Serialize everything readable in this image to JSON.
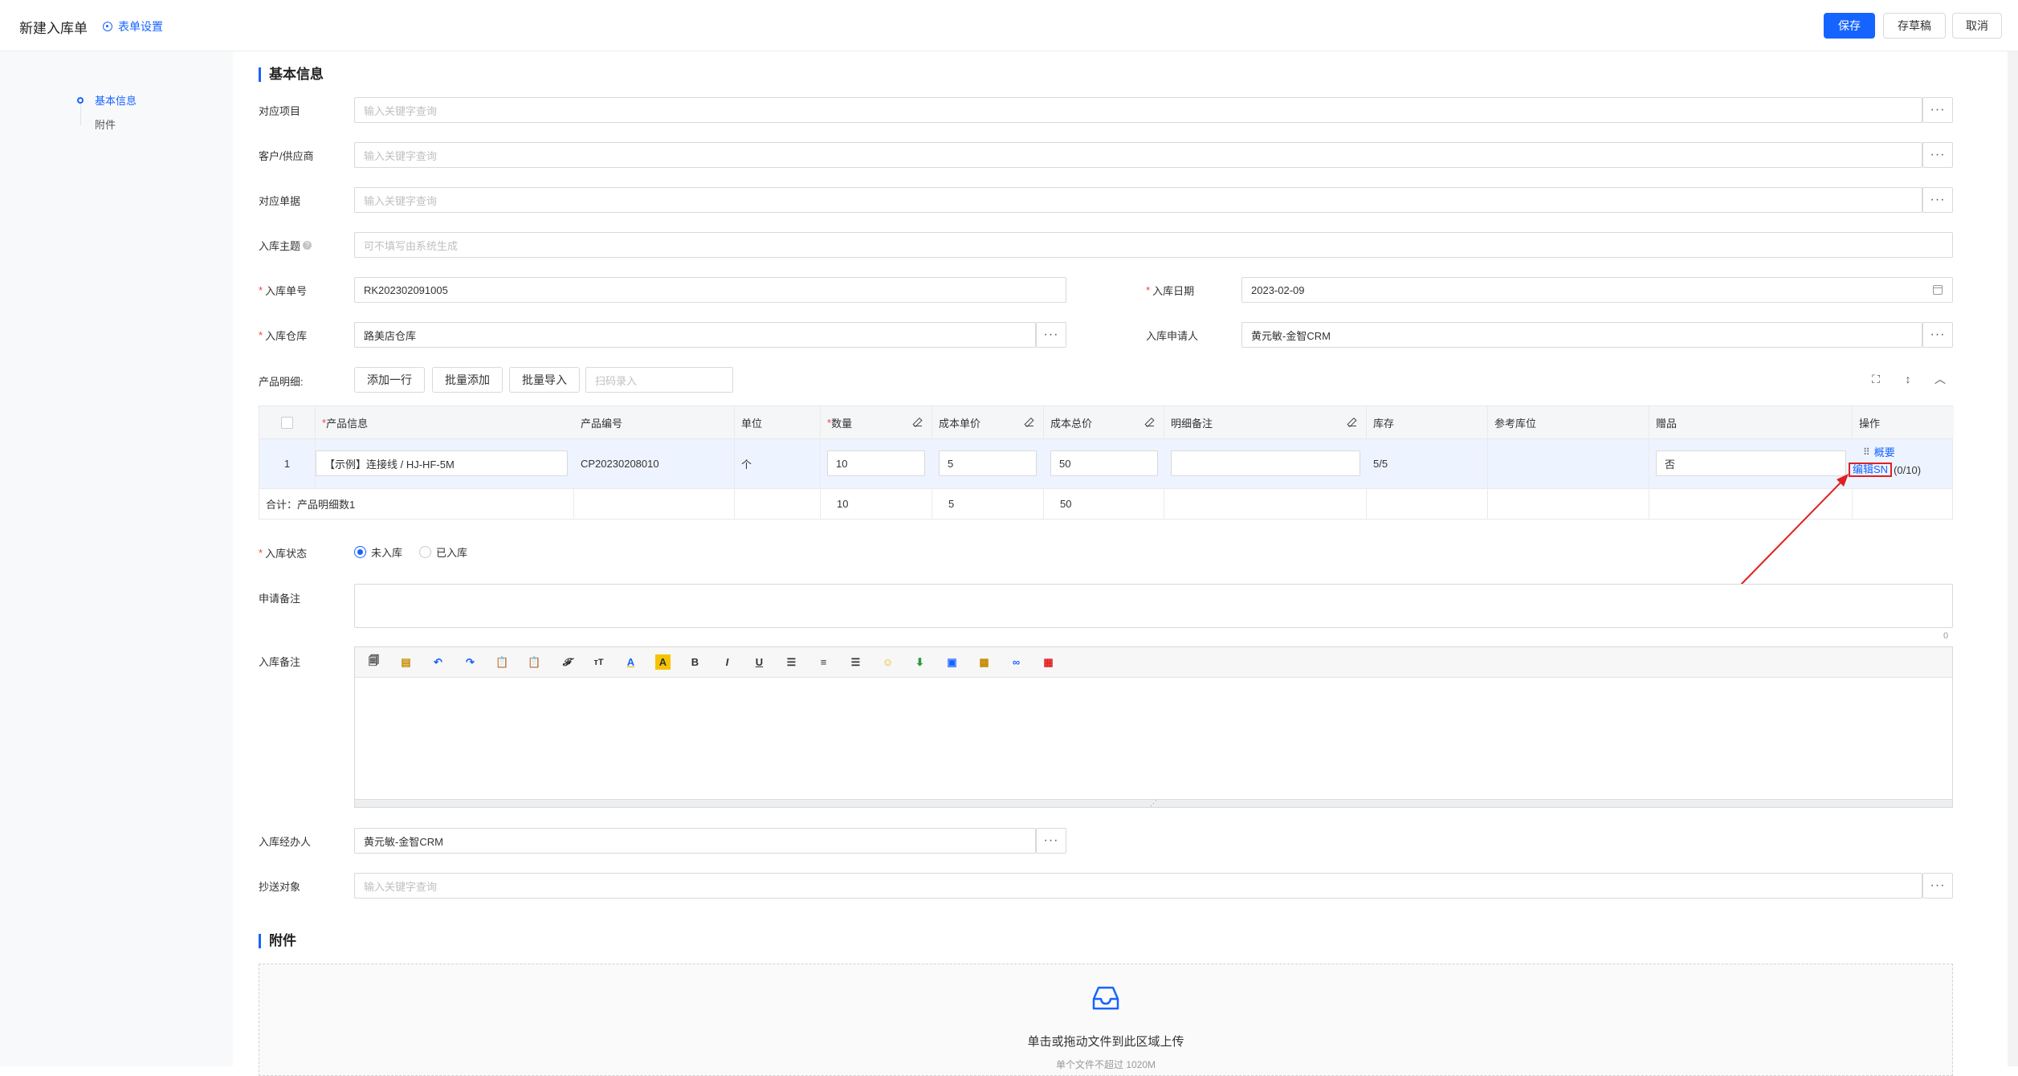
{
  "header": {
    "title": "新建入库单",
    "form_settings": "表单设置",
    "save": "保存",
    "draft": "存草稿",
    "cancel": "取消"
  },
  "sidebar": {
    "items": [
      {
        "label": "基本信息",
        "active": true
      },
      {
        "label": "附件",
        "active": false
      }
    ]
  },
  "sections": {
    "basic": "基本信息",
    "attachment": "附件"
  },
  "fields": {
    "project": {
      "label": "对应项目",
      "placeholder": "输入关键字查询"
    },
    "customer": {
      "label": "客户/供应商",
      "placeholder": "输入关键字查询"
    },
    "document": {
      "label": "对应单据",
      "placeholder": "输入关键字查询"
    },
    "subject": {
      "label": "入库主题",
      "placeholder": "可不填写由系统生成"
    },
    "number": {
      "label": "入库单号",
      "value": "RK202302091005"
    },
    "date": {
      "label": "入库日期",
      "value": "2023-02-09"
    },
    "warehouse": {
      "label": "入库仓库",
      "value": "路美店仓库"
    },
    "applicant": {
      "label": "入库申请人",
      "value": "黄元敏-金智CRM"
    },
    "products_label": "产品明细:",
    "status": {
      "label": "入库状态",
      "options": [
        "未入库",
        "已入库"
      ],
      "selected": "未入库"
    },
    "apply_note": {
      "label": "申请备注",
      "count": "0"
    },
    "stock_note": {
      "label": "入库备注"
    },
    "handler": {
      "label": "入库经办人",
      "value": "黄元敏-金智CRM"
    },
    "cc": {
      "label": "抄送对象",
      "placeholder": "输入关键字查询"
    }
  },
  "product_actions": {
    "add_row": "添加一行",
    "batch_add": "批量添加",
    "batch_import": "批量导入",
    "scan_placeholder": "扫码录入"
  },
  "table": {
    "headers": [
      "",
      "产品信息",
      "产品编号",
      "单位",
      "数量",
      "成本单价",
      "成本总价",
      "明细备注",
      "库存",
      "参考库位",
      "赠品",
      "操作"
    ],
    "rows": [
      {
        "index": "1",
        "product": "【示例】连接线 / HJ-HF-5M",
        "code": "CP20230208010",
        "unit": "个",
        "qty": "10",
        "unit_cost": "5",
        "total_cost": "50",
        "note": "",
        "stock": "5/5",
        "location": "",
        "gift": "否",
        "op_summary": "概要",
        "op_edit_sn": "编辑SN",
        "op_sn_count": "(0/10)"
      }
    ],
    "totals": {
      "label": "合计：产品明细数1",
      "qty": "10",
      "unit_cost": "5",
      "total_cost": "50"
    }
  },
  "editor_toolbar": [
    "source-icon",
    "template-icon",
    "undo-icon",
    "redo-icon",
    "paste-icon",
    "paste-text-icon",
    "font-family-icon",
    "font-size-icon",
    "font-color-icon",
    "bg-color-icon",
    "bold-icon",
    "italic-icon",
    "underline-icon",
    "align-left-icon",
    "align-center-icon",
    "align-right-icon",
    "emoji-icon",
    "insert-icon",
    "image-icon",
    "picture-icon",
    "link-icon",
    "table-icon"
  ],
  "upload": {
    "text": "单击或拖动文件到此区域上传",
    "hint": "单个文件不超过 1020M"
  },
  "colors": {
    "accent": "#1664ff",
    "required": "#f53f3f",
    "annotation": "#e02020"
  }
}
